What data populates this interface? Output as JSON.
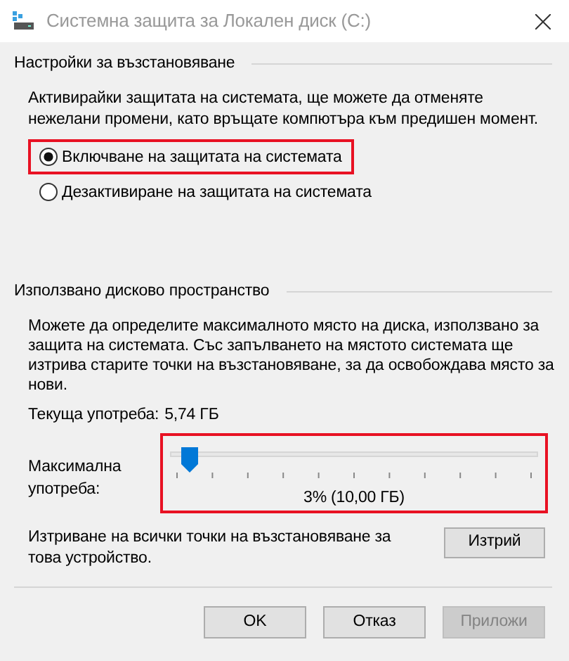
{
  "window": {
    "title": "Системна защита за Локален диск (C:)"
  },
  "restore_settings": {
    "heading": "Настройки за възстановяване",
    "description": "Активирайки защитата на системата, ще можете да отменяте нежелани промени, като връщате компютъра към предишен момент.",
    "options": [
      {
        "label": "Включване на защитата на системата",
        "selected": true,
        "highlighted": true
      },
      {
        "label": "Дезактивиране на защитата на системата",
        "selected": false,
        "highlighted": false
      }
    ]
  },
  "disk_space": {
    "heading": "Използвано дисково пространство",
    "description": "Можете да определите максималното място на диска, използвано за защита на системата. Със запълването на мястото системата ще изтрива старите точки на възстановяване, за да освобождава място за нови.",
    "current_usage_label": "Текуща употреба:",
    "current_usage": "5,74 ГБ",
    "max_usage": {
      "label": "Максимална употреба:",
      "level": 0.03,
      "reading": "3% (10,00 ГБ)",
      "highlighted": true
    },
    "delete_text": "Изтриване на всички точки на възстановяване за това устройство.",
    "delete_button": "Изтрий"
  },
  "buttons": [
    {
      "label": "OK",
      "disabled": false
    },
    {
      "label": "Отказ",
      "disabled": false
    },
    {
      "label": "Приложи",
      "disabled": true
    }
  ]
}
